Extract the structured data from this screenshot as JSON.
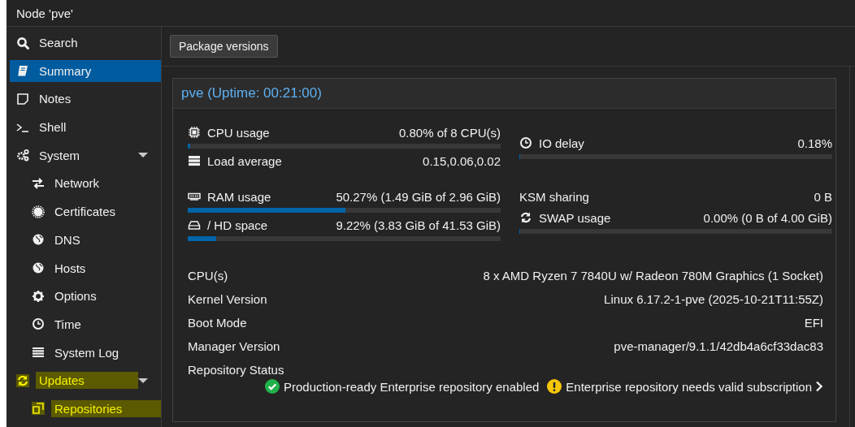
{
  "title": "Node 'pve'",
  "sidebar": {
    "items": [
      {
        "label": "Search",
        "kind": "search",
        "selected": false,
        "highlighted": false
      },
      {
        "label": "Summary",
        "kind": "book",
        "selected": true,
        "highlighted": false
      },
      {
        "label": "Notes",
        "kind": "note",
        "selected": false,
        "highlighted": false
      },
      {
        "label": "Shell",
        "kind": "terminal",
        "selected": false,
        "highlighted": false
      },
      {
        "label": "System",
        "kind": "gears",
        "selected": false,
        "highlighted": false,
        "expanded": true,
        "children": [
          {
            "label": "Network",
            "kind": "arrows",
            "selected": false,
            "highlighted": false
          },
          {
            "label": "Certificates",
            "kind": "cert",
            "selected": false,
            "highlighted": false
          },
          {
            "label": "DNS",
            "kind": "globe",
            "selected": false,
            "highlighted": false
          },
          {
            "label": "Hosts",
            "kind": "globe",
            "selected": false,
            "highlighted": false
          },
          {
            "label": "Options",
            "kind": "gear",
            "selected": false,
            "highlighted": false
          },
          {
            "label": "Time",
            "kind": "clock",
            "selected": false,
            "highlighted": false
          },
          {
            "label": "System Log",
            "kind": "list",
            "selected": false,
            "highlighted": false
          }
        ]
      },
      {
        "label": "Updates",
        "kind": "refresh",
        "selected": false,
        "highlighted": true,
        "expanded": true,
        "children": [
          {
            "label": "Repositories",
            "kind": "copy",
            "selected": false,
            "highlighted": true
          }
        ]
      }
    ]
  },
  "toolbar": {
    "buttons": [
      "Package versions"
    ]
  },
  "panel": {
    "title": "pve (Uptime: 00:21:00)",
    "stat_groups": [
      {
        "left": [
          {
            "label": "CPU usage",
            "kind": "chip",
            "value": "0.80% of 8 CPU(s)",
            "level": 0.008
          },
          {
            "label": "Load average",
            "kind": "server",
            "value": "0.15,0.06,0.02"
          }
        ],
        "right": [
          {
            "label": "IO delay",
            "kind": "clock",
            "value": "0.18%",
            "level": 0.0018
          }
        ]
      },
      {
        "left": [
          {
            "label": "RAM usage",
            "kind": "ram",
            "value": "50.27% (1.49 GiB of 2.96 GiB)",
            "level": 0.5027
          },
          {
            "label": "/ HD space",
            "kind": "disk",
            "value": "9.22% (3.83 GiB of 41.53 GiB)",
            "level": 0.0922
          }
        ],
        "right": [
          {
            "label": "KSM sharing",
            "value": "0 B"
          },
          {
            "label": "SWAP usage",
            "kind": "refresh",
            "value": "0.00% (0 B of 4.00 GiB)",
            "level": 0.0
          }
        ]
      }
    ],
    "info": [
      {
        "label": "CPU(s)",
        "value": "8 x AMD Ryzen 7 7840U w/ Radeon 780M Graphics (1 Socket)"
      },
      {
        "label": "Kernel Version",
        "value": "Linux 6.17.2-1-pve (2025-10-21T11:55Z)"
      },
      {
        "label": "Boot Mode",
        "value": "EFI"
      },
      {
        "label": "Manager Version",
        "value": "pve-manager/9.1.1/42db4a6cf33dac83"
      }
    ],
    "repository_status": {
      "label": "Repository Status",
      "statuses": [
        {
          "kind": "ok",
          "text": "Production-ready Enterprise repository enabled"
        },
        {
          "kind": "warning",
          "text": "Enterprise repository needs valid subscription"
        }
      ],
      "has_details": true
    }
  }
}
